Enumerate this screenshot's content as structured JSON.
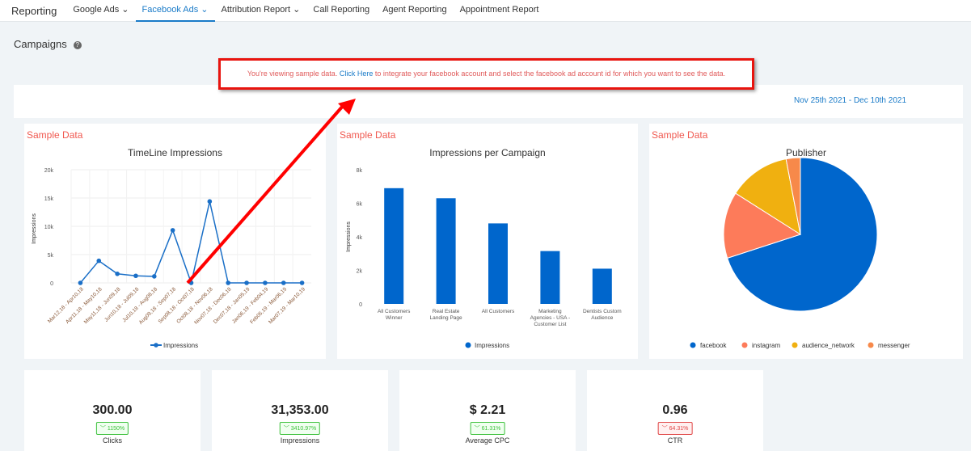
{
  "nav": {
    "brand": "Reporting",
    "items": [
      "Google Ads ⌄",
      "Facebook Ads ⌄",
      "Attribution Report ⌄",
      "Call Reporting",
      "Agent Reporting",
      "Appointment Report"
    ]
  },
  "page": {
    "title": "Campaigns"
  },
  "banner": {
    "pre": "You're viewing sample data. ",
    "link": "Click Here",
    "post": " to integrate your facebook account and select the facebook ad account id for which you want to see the data."
  },
  "date_range": "Nov 25th 2021 - Dec 10th 2021",
  "sample_label": "Sample Data",
  "colors": {
    "accent": "#1a7bc8",
    "series": "#0066cc",
    "sample": "#f0584f",
    "banner_border": "#e8140f"
  },
  "chart_data": [
    {
      "type": "line",
      "title": "TimeLine Impressions",
      "ylabel": "Impressions",
      "ylim": [
        0,
        20000
      ],
      "yticks": [
        "0",
        "5k",
        "10k",
        "15k",
        "20k"
      ],
      "grid": true,
      "legend": "bottom",
      "categories": [
        "Mar12,18 - Apr10,18",
        "Apr11,18 - May10,18",
        "May11,18 - Jun09,18",
        "Jun10,18 - Jul09,18",
        "Jul10,18 - Aug08,18",
        "Aug09,18 - Sep07,18",
        "Sep08,18 - Oct07,18",
        "Oct08,18 - Nov06,18",
        "Nov07,18 - Dec06,18",
        "Dec07,18 - Jan05,19",
        "Jan06,19 - Feb04,19",
        "Feb05,19 - Mar06,19",
        "Mar07,19 - Mar10,19"
      ],
      "series": [
        {
          "name": "Impressions",
          "values": [
            0,
            3900,
            1600,
            1250,
            1150,
            9300,
            0,
            14400,
            0,
            0,
            0,
            0,
            0
          ]
        }
      ]
    },
    {
      "type": "bar",
      "title": "Impressions per Campaign",
      "ylabel": "Impressions",
      "ylim": [
        0,
        8000
      ],
      "yticks": [
        "0",
        "2k",
        "4k",
        "6k",
        "8k"
      ],
      "legend": "bottom",
      "categories": [
        [
          "All Customers",
          "Winner"
        ],
        [
          "Real Estate",
          "Landing Page"
        ],
        [
          "All Customers"
        ],
        [
          "Marketing",
          "Agencies - USA -",
          "Customer List"
        ],
        [
          "Dentists Custom",
          "Audience"
        ]
      ],
      "series": [
        {
          "name": "Impressions",
          "values": [
            6900,
            6300,
            4800,
            3150,
            2100
          ]
        }
      ]
    },
    {
      "type": "pie",
      "title": "Publisher",
      "legend": "bottom",
      "slices": [
        {
          "name": "facebook",
          "value": 70,
          "color": "#0066cc"
        },
        {
          "name": "instagram",
          "value": 14,
          "color": "#fd7b5a"
        },
        {
          "name": "audience_network",
          "value": 13,
          "color": "#f0b010"
        },
        {
          "name": "messenger",
          "value": 3,
          "color": "#f7894a"
        }
      ]
    }
  ],
  "stats": [
    {
      "value": "300.00",
      "change": "1150%",
      "label": "Clicks",
      "trend": "up"
    },
    {
      "value": "31,353.00",
      "change": "3410.97%",
      "label": "Impressions",
      "trend": "up"
    },
    {
      "value": "$ 2.21",
      "change": "61.31%",
      "label": "Average CPC",
      "trend": "up"
    },
    {
      "value": "0.96",
      "change": "64.31%",
      "label": "CTR",
      "trend": "down"
    }
  ]
}
